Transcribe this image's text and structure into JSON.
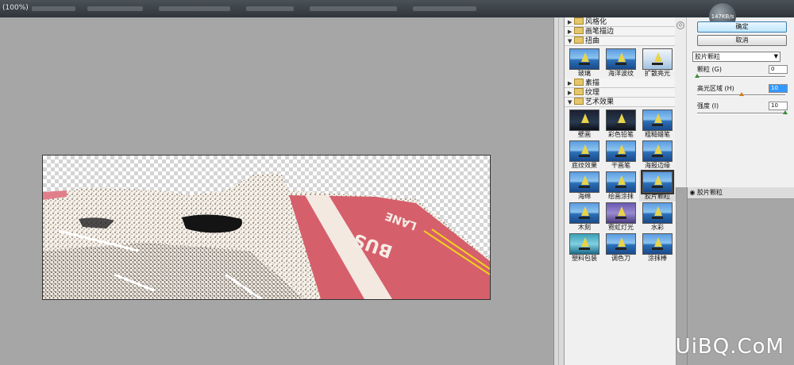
{
  "window": {
    "title": "(100%)"
  },
  "status": {
    "bandwidth": "147KB/s"
  },
  "gallery": {
    "categories": [
      {
        "label": "风格化",
        "expanded": false
      },
      {
        "label": "画笔描边",
        "expanded": false
      },
      {
        "label": "扭曲",
        "expanded": true,
        "filters": [
          "玻璃",
          "海洋波纹",
          "扩散亮光"
        ]
      },
      {
        "label": "素描",
        "expanded": false
      },
      {
        "label": "纹理",
        "expanded": false
      },
      {
        "label": "艺术效果",
        "expanded": true,
        "filters": [
          "壁画",
          "彩色铅笔",
          "粗糙蜡笔",
          "底纹效果",
          "干画笔",
          "海报边缘",
          "海绵",
          "绘画涂抹",
          "胶片颗粒",
          "木刻",
          "霓虹灯光",
          "水彩",
          "塑料包装",
          "调色刀",
          "涂抹棒"
        ]
      }
    ],
    "selected_filter": "胶片颗粒"
  },
  "buttons": {
    "ok": "确定",
    "cancel": "取消"
  },
  "filter_select": {
    "value": "胶片颗粒"
  },
  "params": {
    "grain": {
      "label": "颗粒 (G)",
      "value": "0",
      "level": 0
    },
    "highlight": {
      "label": "高光区域 (H)",
      "value": "10",
      "level": 0.5
    },
    "intensity": {
      "label": "强度 (I)",
      "value": "10",
      "level": 1.0
    }
  },
  "layers": {
    "row_label": "胶片颗粒"
  },
  "watermark": "UiBQ.CoM"
}
